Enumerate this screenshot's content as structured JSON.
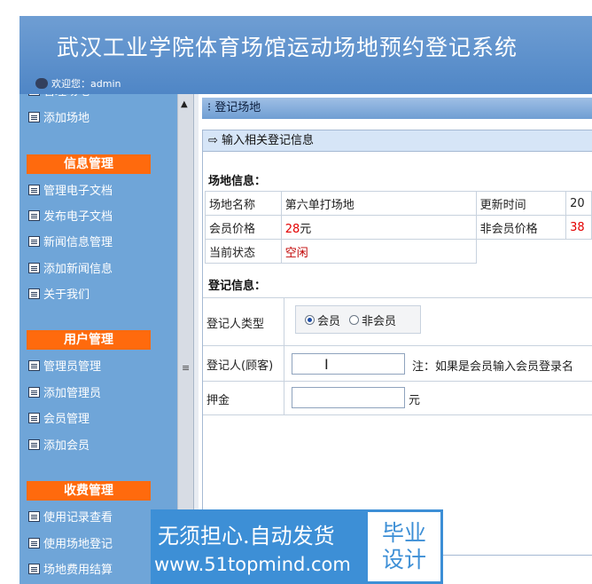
{
  "header": {
    "title": "武汉工业学院体育场馆运动场地预约登记系统",
    "welcome": "欢迎您：admin"
  },
  "sidebar": {
    "top_items": [
      "添加场地"
    ],
    "sections": [
      {
        "title": "信息管理",
        "items": [
          "管理电子文档",
          "发布电子文档",
          "新闻信息管理",
          "添加新闻信息",
          "关于我们"
        ]
      },
      {
        "title": "用户管理",
        "items": [
          "管理员管理",
          "添加管理员",
          "会员管理",
          "添加会员"
        ]
      },
      {
        "title": "收费管理",
        "items": [
          "使用记录查看",
          "使用场地登记",
          "场地费用结算"
        ]
      }
    ]
  },
  "main": {
    "titlebar": "登记场地",
    "panel_header": "输入相关登记信息",
    "venue_section_title": "场地信息：",
    "venue": {
      "name_label": "场地名称",
      "name_value": "第六单打场地",
      "update_label": "更新时间",
      "update_value": "20",
      "member_price_label": "会员价格",
      "member_price_value": "28",
      "member_price_unit": "元",
      "nonmember_price_label": "非会员价格",
      "nonmember_price_value": "38",
      "status_label": "当前状态",
      "status_value": "空闲"
    },
    "reg_section_title": "登记信息：",
    "reg": {
      "type_label": "登记人类型",
      "option_member": "会员",
      "option_nonmember": "非会员",
      "registrant_label": "登记人(顾客)",
      "registrant_value": "",
      "registrant_note": "注：如果是会员输入会员登录名",
      "deposit_label": "押金",
      "deposit_value": "",
      "deposit_unit": "元"
    }
  },
  "banner": {
    "slogan": "无须担心.自动发货",
    "url": "www.51topmind.com",
    "badge_line1": "毕业",
    "badge_line2": "设计"
  }
}
